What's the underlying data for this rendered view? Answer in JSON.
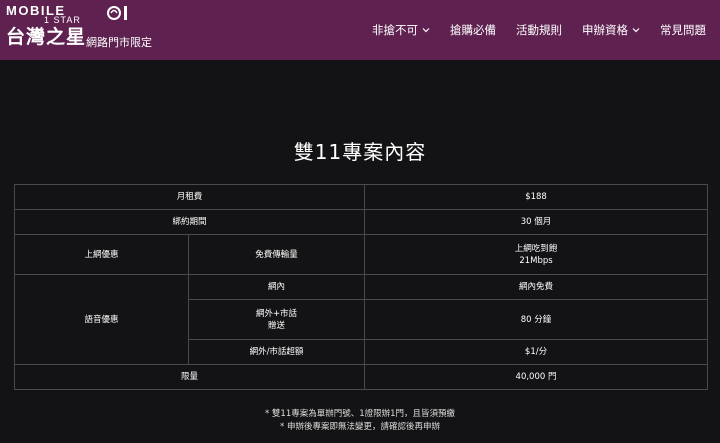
{
  "header": {
    "logo_mobile": "MOBILE",
    "logo_star": "1 STAR",
    "logo_name": "台灣之星",
    "logo_tag": "網路門市限定",
    "nav": [
      {
        "label": "非搶不可",
        "dropdown": true
      },
      {
        "label": "搶購必備",
        "dropdown": false
      },
      {
        "label": "活動規則",
        "dropdown": false
      },
      {
        "label": "申辦資格",
        "dropdown": true
      },
      {
        "label": "常見問題",
        "dropdown": false
      }
    ]
  },
  "main": {
    "title": "雙11專案內容",
    "table": {
      "monthly_fee_label": "月租費",
      "monthly_fee_value": "$188",
      "contract_label": "綁約期間",
      "contract_value": "30 個月",
      "internet_label": "上網優惠",
      "free_data_label": "免費傳輸量",
      "free_data_value_1": "上網吃到飽",
      "free_data_value_2": "21Mbps",
      "voice_label": "語音優惠",
      "on_net_label": "網內",
      "on_net_value": "網內免費",
      "off_net_label_1": "網外+市話",
      "off_net_label_2": "贈送",
      "off_net_value": "80 分鐘",
      "overage_label": "網外/市話超額",
      "overage_value": "$1/分",
      "limit_label": "限量",
      "limit_value": "40,000 門"
    },
    "notes": [
      "* 雙11專案為單辦門號、1證限辦1門，且皆須預繳",
      "* 申辦後專案即無法變更，請確認後再申辦"
    ]
  },
  "colors": {
    "header_bg": "#5e2150",
    "page_bg": "#131315",
    "table_border": "#4a4a4c"
  }
}
